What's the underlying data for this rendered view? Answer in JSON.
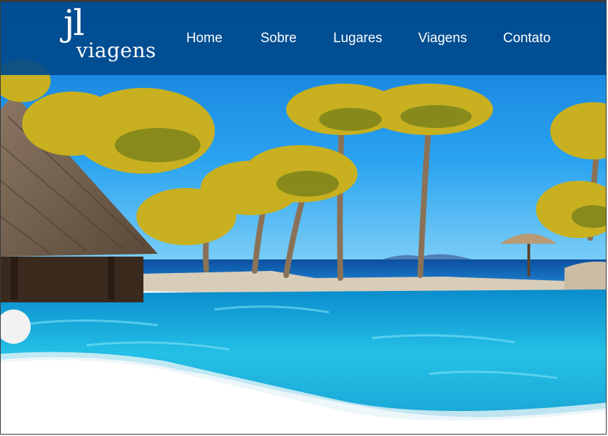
{
  "logo": {
    "mark": "jl",
    "word": "viagens"
  },
  "nav": {
    "items": [
      {
        "label": "Home"
      },
      {
        "label": "Sobre"
      },
      {
        "label": "Lugares"
      },
      {
        "label": "Viagens"
      },
      {
        "label": "Contato"
      }
    ]
  },
  "colors": {
    "navbar": "#004A8C",
    "sky": "#1E8FE8",
    "sea": "#0A5BB0",
    "pool": "#22B8E0",
    "palm": "#C8B020",
    "hut_roof": "#6E5B48"
  }
}
